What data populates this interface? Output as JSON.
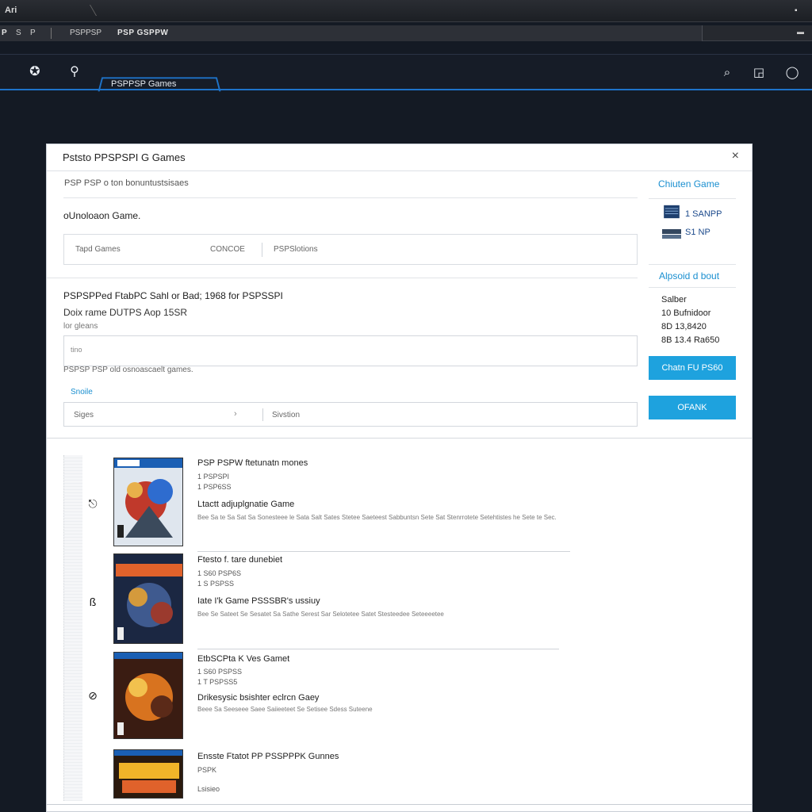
{
  "window": {
    "title": "Ari"
  },
  "menubar": {
    "items": [
      "P",
      "S",
      "P",
      "PSPPSP",
      "PSP GSPPW"
    ]
  },
  "header": {
    "tab_label": "PSPPSP Games",
    "left_icons": [
      "settings-icon",
      "user-icon"
    ],
    "right_icons": [
      "search-icon",
      "window-icon",
      "chat-icon"
    ]
  },
  "dialog": {
    "title": "Pststo PPSPSPI G Games",
    "close": "×",
    "subhead": "PSP PSP  o ton bonuntustsisaes",
    "section1": "oUnoloaon Game.",
    "filter": {
      "col1": "Tapd Games",
      "col2": "CONCOE",
      "col3": "PSPSlotions"
    },
    "heading2": "PSPSPPed FtabPC Sahl or Bad; 1968 for PSPSSPI",
    "heading3": "Doix rame DUTPS Aop 15SR",
    "small_label": "lor gleans",
    "input_placeholder": "tino",
    "hint": "PSPSP PSP old osnoascaelt games.",
    "blue_label": "Snoile",
    "select": {
      "value": "Siges",
      "right": "Sivstion"
    }
  },
  "side": {
    "title": "Chiuten Game",
    "stats": [
      "1 SANPP",
      "S1 NP"
    ],
    "sub_title": "Alpsoid d bout",
    "info": [
      "Salber",
      "10 Bufnidoor",
      "8D 13,8420",
      "8B 13.4 Ra650"
    ],
    "button1": "Chatn FU PS60",
    "button2": "OFANK"
  },
  "results": [
    {
      "title": "PSP PSPW ftetunatn mones",
      "meta": [
        "1 PSPSPI",
        "1 PSP6SS"
      ],
      "subtitle": "Ltactt adjuplgnatie Game",
      "desc": "Bee Sa te Sa Sat Sa Sonesteee le Sata Salt Sates Stetee Saeteest Sabbuntsn Sete Sat Stenrrotete Setehtistes he Sete te Sec."
    },
    {
      "title": "Ftesto f. tare dunebiet",
      "meta": [
        "1 S60 PSP6S",
        "1 S PSPSS"
      ],
      "subtitle": "Iate I'k Game PSSSBR's ussiuy",
      "desc": "Bee Se Sateet Se Sesatet Sa Sathe Serest Sar Selotetee Satet Stesteedee Seteeeetee"
    },
    {
      "title": "EtbSCPta K Ves Gamet",
      "meta": [
        "1 S60 PSPSS",
        "1 T PSPSS5"
      ],
      "subtitle": "Drikesysic bsishter eclrcn Gaey",
      "desc": "Beee Sa Seeseee Saee Saiieeteet Se Setisee Sdess Suteene"
    },
    {
      "title": "Ensste Ftatot PP PSSPPPK Gunnes",
      "meta": [
        "PSPK",
        "Lsisieo"
      ],
      "subtitle": "",
      "desc": ""
    }
  ],
  "colors": {
    "accent": "#1ea2de",
    "header_blue": "#1e73c9",
    "bg": "#141a24"
  }
}
